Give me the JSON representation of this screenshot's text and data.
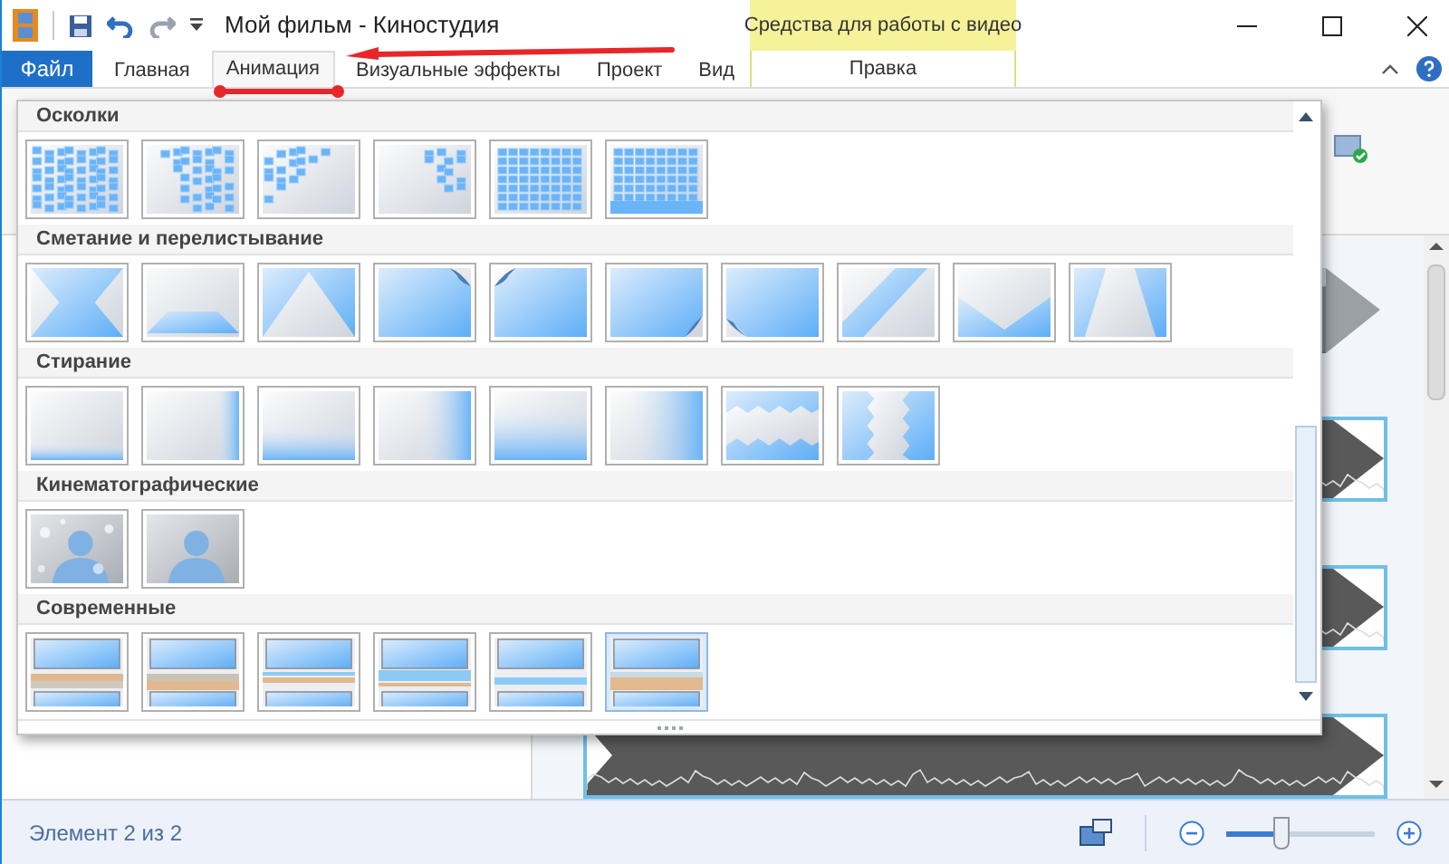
{
  "window": {
    "title": "Мой фильм - Киностудия",
    "context_group": "Средства для работы с видео"
  },
  "ribbon_tabs": [
    {
      "label": "Файл",
      "kind": "file",
      "selected": false
    },
    {
      "label": "Главная",
      "kind": "tab",
      "selected": false
    },
    {
      "label": "Анимация",
      "kind": "tab",
      "selected": true
    },
    {
      "label": "Визуальные эффекты",
      "kind": "tab",
      "selected": false
    },
    {
      "label": "Проект",
      "kind": "tab",
      "selected": false
    },
    {
      "label": "Вид",
      "kind": "tab",
      "selected": false
    },
    {
      "label": "Правка",
      "kind": "context",
      "selected": false
    }
  ],
  "transition_gallery": {
    "sections": [
      {
        "title": "Осколки",
        "items": [
          {
            "selected": false
          },
          {
            "selected": false
          },
          {
            "selected": false
          },
          {
            "selected": false
          },
          {
            "selected": false
          },
          {
            "selected": false
          }
        ]
      },
      {
        "title": "Сметание и перелистывание",
        "items": [
          {
            "selected": false
          },
          {
            "selected": false
          },
          {
            "selected": false
          },
          {
            "selected": false
          },
          {
            "selected": false
          },
          {
            "selected": false
          },
          {
            "selected": false
          },
          {
            "selected": false
          },
          {
            "selected": false
          },
          {
            "selected": false
          }
        ]
      },
      {
        "title": "Стирание",
        "items": [
          {
            "selected": false
          },
          {
            "selected": false
          },
          {
            "selected": false
          },
          {
            "selected": false
          },
          {
            "selected": false
          },
          {
            "selected": false
          },
          {
            "selected": false
          },
          {
            "selected": false
          }
        ]
      },
      {
        "title": "Кинематографические",
        "items": [
          {
            "selected": false
          },
          {
            "selected": false
          }
        ]
      },
      {
        "title": "Современные",
        "items": [
          {
            "selected": false
          },
          {
            "selected": false
          },
          {
            "selected": false
          },
          {
            "selected": false
          },
          {
            "selected": false
          },
          {
            "selected": true
          }
        ]
      }
    ]
  },
  "status_bar": {
    "text": "Элемент 2 из 2",
    "zoom": {
      "level": 0.37
    }
  }
}
